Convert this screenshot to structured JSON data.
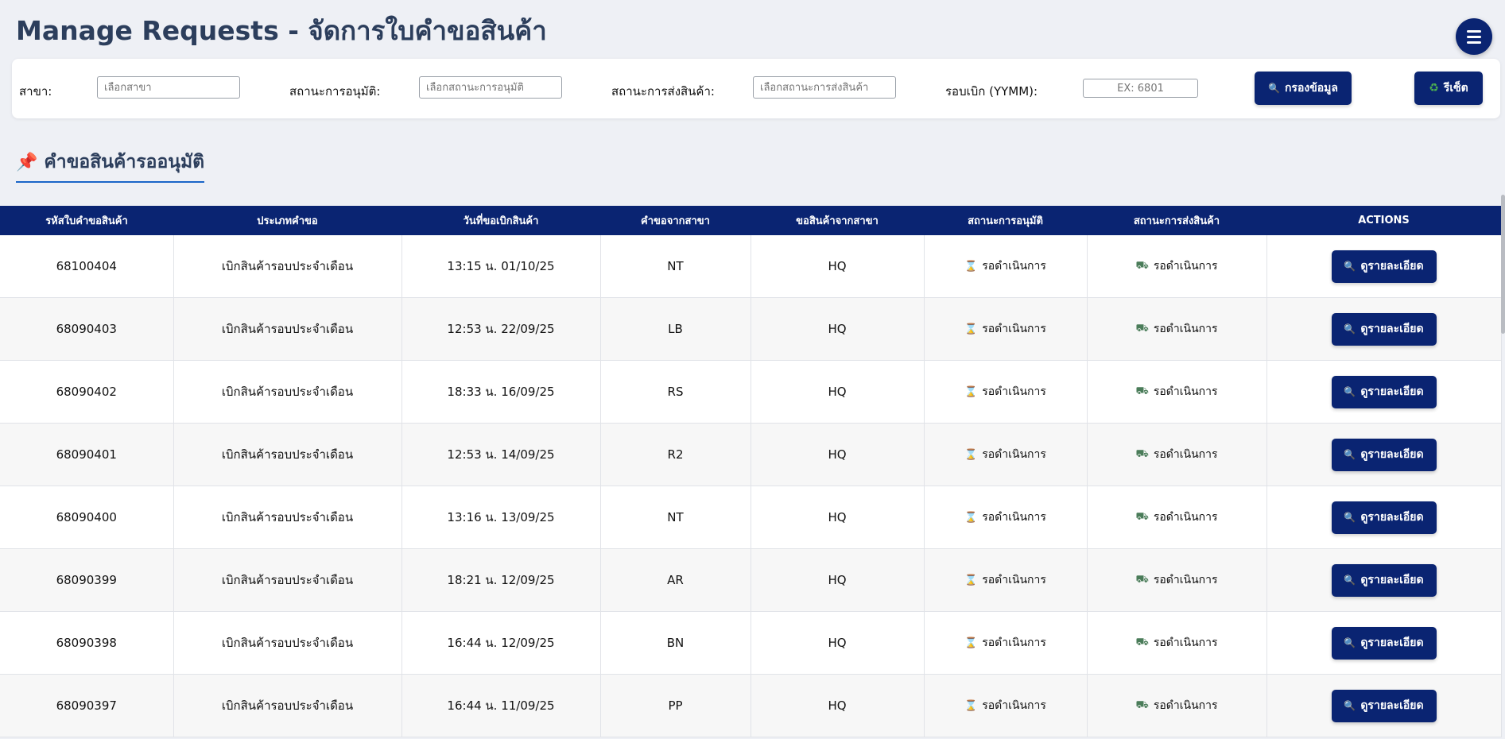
{
  "page": {
    "title": "Manage Requests - จัดการใบคำขอสินค้า"
  },
  "filters": {
    "branch": {
      "label": "สาขา:",
      "placeholder": "เลือกสาขา"
    },
    "approval": {
      "label": "สถานะการอนุมัติ:",
      "placeholder": "เลือกสถานะการอนุมัติ"
    },
    "shipping": {
      "label": "สถานะการส่งสินค้า:",
      "placeholder": "เลือกสถานะการส่งสินค้า"
    },
    "round": {
      "label": "รอบเบิก (YYMM):",
      "placeholder": "EX: 6801"
    },
    "filter_button": "กรองข้อมูล",
    "reset_button": "รีเซ็ต"
  },
  "section": {
    "title": "คำขอสินค้ารออนุมัติ"
  },
  "table": {
    "headers": [
      "รหัสใบคำขอสินค้า",
      "ประเภทคำขอ",
      "วันที่ขอเบิกสินค้า",
      "คำขอจากสาขา",
      "ขอสินค้าจากสาขา",
      "สถานะการอนุมัติ",
      "สถานะการส่งสินค้า",
      "ACTIONS"
    ],
    "rows": [
      {
        "id": "68100404",
        "type": "เบิกสินค้ารอบประจำเดือน",
        "date": "13:15 น. 01/10/25",
        "from": "NT",
        "to": "HQ",
        "approval": "รอดำเนินการ",
        "shipping": "รอดำเนินการ",
        "action": "ดูรายละเอียด"
      },
      {
        "id": "68090403",
        "type": "เบิกสินค้ารอบประจำเดือน",
        "date": "12:53 น. 22/09/25",
        "from": "LB",
        "to": "HQ",
        "approval": "รอดำเนินการ",
        "shipping": "รอดำเนินการ",
        "action": "ดูรายละเอียด"
      },
      {
        "id": "68090402",
        "type": "เบิกสินค้ารอบประจำเดือน",
        "date": "18:33 น. 16/09/25",
        "from": "RS",
        "to": "HQ",
        "approval": "รอดำเนินการ",
        "shipping": "รอดำเนินการ",
        "action": "ดูรายละเอียด"
      },
      {
        "id": "68090401",
        "type": "เบิกสินค้ารอบประจำเดือน",
        "date": "12:53 น. 14/09/25",
        "from": "R2",
        "to": "HQ",
        "approval": "รอดำเนินการ",
        "shipping": "รอดำเนินการ",
        "action": "ดูรายละเอียด"
      },
      {
        "id": "68090400",
        "type": "เบิกสินค้ารอบประจำเดือน",
        "date": "13:16 น. 13/09/25",
        "from": "NT",
        "to": "HQ",
        "approval": "รอดำเนินการ",
        "shipping": "รอดำเนินการ",
        "action": "ดูรายละเอียด"
      },
      {
        "id": "68090399",
        "type": "เบิกสินค้ารอบประจำเดือน",
        "date": "18:21 น. 12/09/25",
        "from": "AR",
        "to": "HQ",
        "approval": "รอดำเนินการ",
        "shipping": "รอดำเนินการ",
        "action": "ดูรายละเอียด"
      },
      {
        "id": "68090398",
        "type": "เบิกสินค้ารอบประจำเดือน",
        "date": "16:44 น. 12/09/25",
        "from": "BN",
        "to": "HQ",
        "approval": "รอดำเนินการ",
        "shipping": "รอดำเนินการ",
        "action": "ดูรายละเอียด"
      },
      {
        "id": "68090397",
        "type": "เบิกสินค้ารอบประจำเดือน",
        "date": "16:44 น. 11/09/25",
        "from": "PP",
        "to": "HQ",
        "approval": "รอดำเนินการ",
        "shipping": "รอดำเนินการ",
        "action": "ดูรายละเอียด"
      }
    ]
  },
  "icons": {
    "menu": "hamburger-icon",
    "filter": "magnifier-icon",
    "reset": "recycle-icon",
    "section": "pushpin-icon",
    "approval": "hourglass-icon",
    "shipping": "truck-icon",
    "detail": "magnifier-icon"
  },
  "colors": {
    "primary": "#0a2472",
    "title": "#2c3e5c",
    "background": "#eef0f5"
  }
}
